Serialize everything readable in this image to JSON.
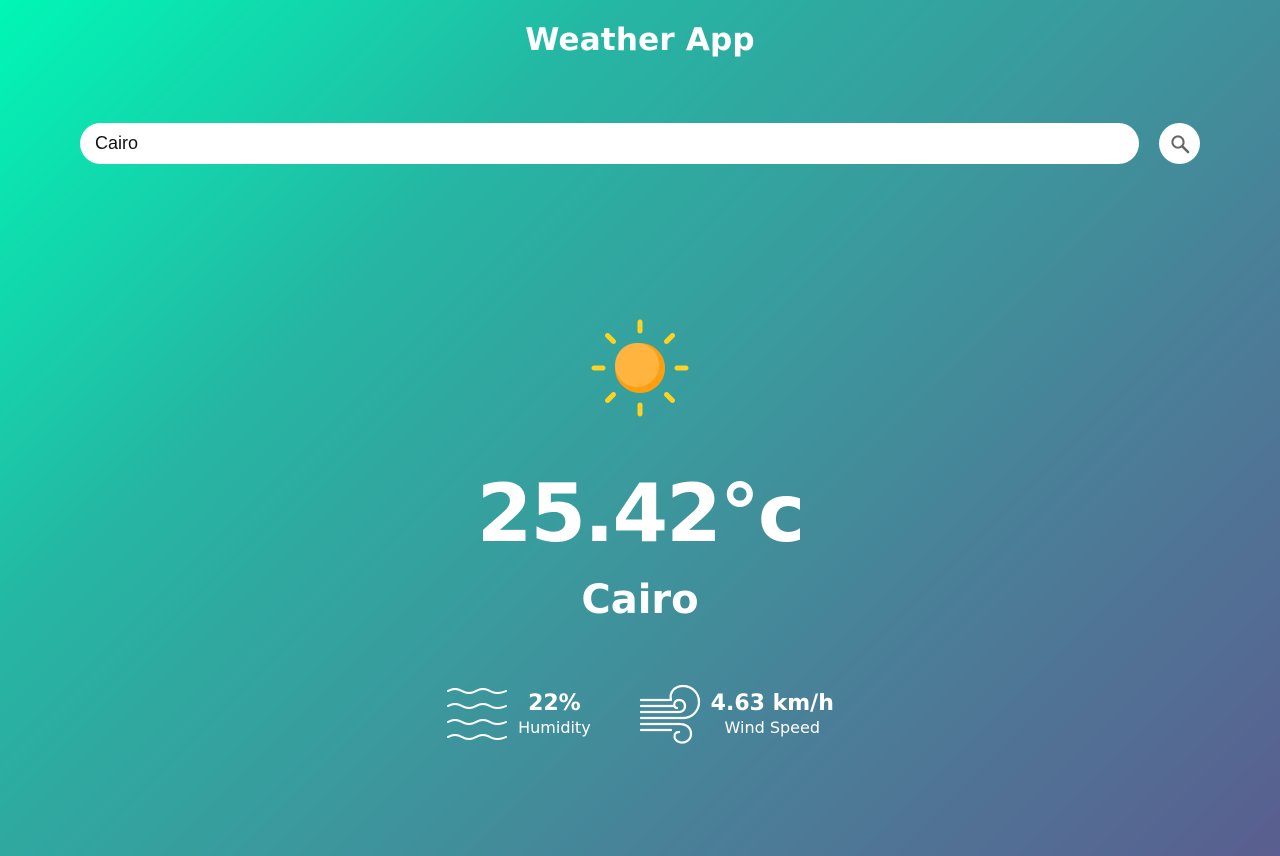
{
  "app": {
    "title": "Weather App"
  },
  "search": {
    "value": "Cairo",
    "icon": "search-icon"
  },
  "weather": {
    "icon": "sun-icon",
    "temperature": "25.42°c",
    "city": "Cairo"
  },
  "details": {
    "humidity": {
      "icon": "humidity-waves-icon",
      "value": "22%",
      "label": "Humidity"
    },
    "wind": {
      "icon": "wind-icon",
      "value": "4.63 km/h",
      "label": "Wind Speed"
    }
  },
  "colors": {
    "gradient_start": "#00f7b6",
    "gradient_end": "#5a5e90",
    "sun_core": "#ffb13b",
    "sun_rays": "#ffd21f",
    "text": "#ffffff"
  }
}
